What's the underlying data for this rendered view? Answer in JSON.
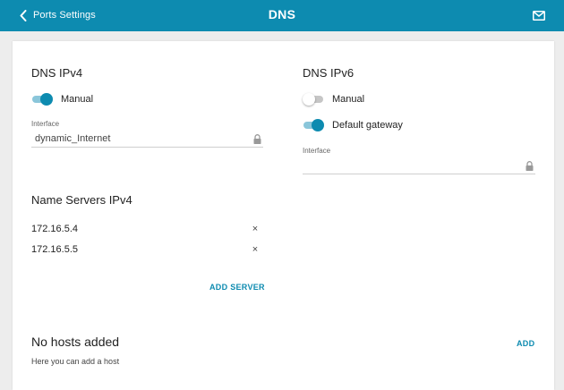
{
  "header": {
    "back_label": "Ports Settings",
    "title": "DNS"
  },
  "ipv4": {
    "title": "DNS IPv4",
    "manual_label": "Manual",
    "manual_on": true,
    "interface_label": "Interface",
    "interface_value": "dynamic_Internet"
  },
  "ipv6": {
    "title": "DNS IPv6",
    "manual_label": "Manual",
    "manual_on": false,
    "gateway_label": "Default gateway",
    "gateway_on": true,
    "interface_label": "Interface",
    "interface_value": ""
  },
  "name_servers": {
    "title": "Name Servers IPv4",
    "servers": [
      "172.16.5.4",
      "172.16.5.5"
    ],
    "remove_glyph": "×",
    "add_label": "ADD SERVER"
  },
  "hosts": {
    "title": "No hosts added",
    "subtitle": "Here you can add a host",
    "add_label": "ADD"
  },
  "colors": {
    "accent": "#0d8bb0",
    "background": "#ededed"
  }
}
